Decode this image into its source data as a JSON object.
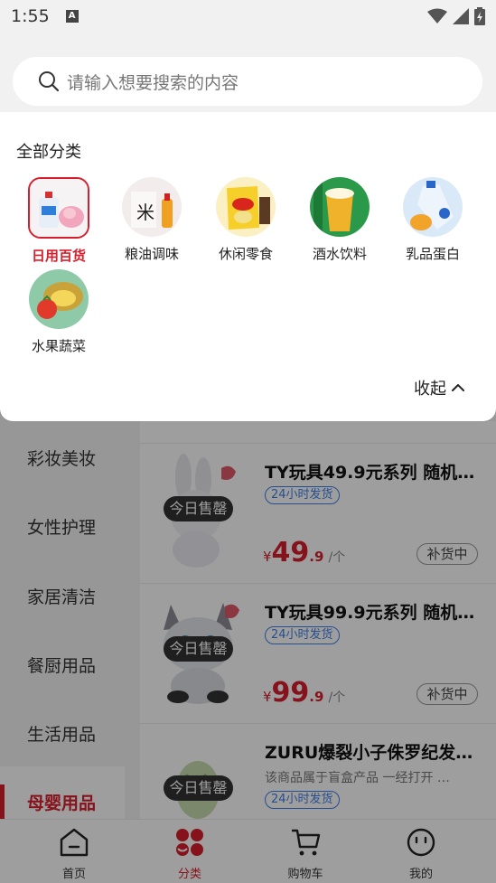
{
  "status_bar": {
    "time": "1:55",
    "a_label": "A"
  },
  "search": {
    "placeholder": "请输入想要搜索的内容"
  },
  "category_panel": {
    "heading": "全部分类",
    "items": [
      {
        "label": "日用百货",
        "active": true
      },
      {
        "label": "粮油调味",
        "active": false
      },
      {
        "label": "休闲零食",
        "active": false
      },
      {
        "label": "酒水饮料",
        "active": false
      },
      {
        "label": "乳品蛋白",
        "active": false
      },
      {
        "label": "水果蔬菜",
        "active": false
      }
    ],
    "collapse_label": "收起"
  },
  "left_nav": {
    "items": [
      {
        "label": "彩妆美妆"
      },
      {
        "label": "女性护理"
      },
      {
        "label": "家居清洁"
      },
      {
        "label": "餐厨用品"
      },
      {
        "label": "生活用品"
      },
      {
        "label": "母婴用品",
        "active": true
      }
    ]
  },
  "products": [
    {
      "title": "TY玩具49.9元系列 随机…",
      "sold_badge": "今日售罄",
      "ship_tag": "24小时发货",
      "price_symbol": "¥",
      "price_int": "49",
      "price_dec": ".9",
      "unit": "/个",
      "restock_label": "补货中"
    },
    {
      "title": "TY玩具99.9元系列 随机…",
      "sold_badge": "今日售罄",
      "ship_tag": "24小时发货",
      "price_symbol": "¥",
      "price_int": "99",
      "price_dec": ".9",
      "unit": "/个",
      "restock_label": "补货中"
    },
    {
      "title": "ZURU爆裂小子侏罗纪发…",
      "desc": "该商品属于盲盒产品 一经打开 …",
      "sold_badge": "今日售罄",
      "ship_tag": "24小时发货"
    }
  ],
  "tabbar": {
    "tabs": [
      {
        "label": "首页",
        "icon": "home-icon"
      },
      {
        "label": "分类",
        "icon": "category-icon",
        "active": true
      },
      {
        "label": "购物车",
        "icon": "cart-icon"
      },
      {
        "label": "我的",
        "icon": "profile-icon"
      }
    ]
  },
  "colors": {
    "accent": "#d81e2c",
    "ship_tag": "#3f7fe6"
  }
}
